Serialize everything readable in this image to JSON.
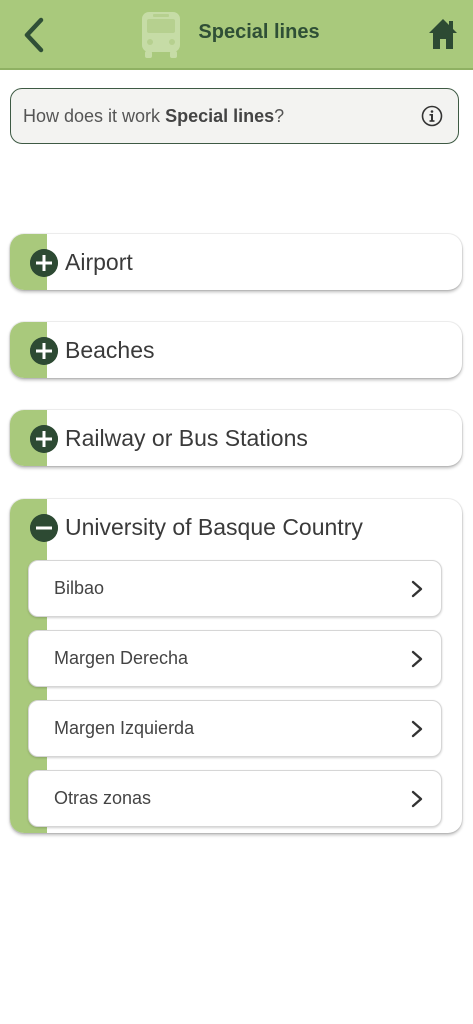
{
  "header": {
    "title": "Special lines",
    "color": "#a9c97c",
    "icons": {
      "back": "chevron-left-icon",
      "bus": "bus-icon",
      "home": "home-icon"
    }
  },
  "info": {
    "prefix": "How does it work ",
    "bold": "Special lines",
    "suffix": "?",
    "icon": "info-icon"
  },
  "categories": [
    {
      "label": "Airport",
      "expanded": false
    },
    {
      "label": "Beaches",
      "expanded": false
    },
    {
      "label": "Railway or Bus Stations",
      "expanded": false
    },
    {
      "label": "University of Basque Country",
      "expanded": true,
      "items": [
        {
          "label": "Bilbao"
        },
        {
          "label": "Margen Derecha"
        },
        {
          "label": "Margen Izquierda"
        },
        {
          "label": "Otras zonas"
        }
      ]
    }
  ]
}
